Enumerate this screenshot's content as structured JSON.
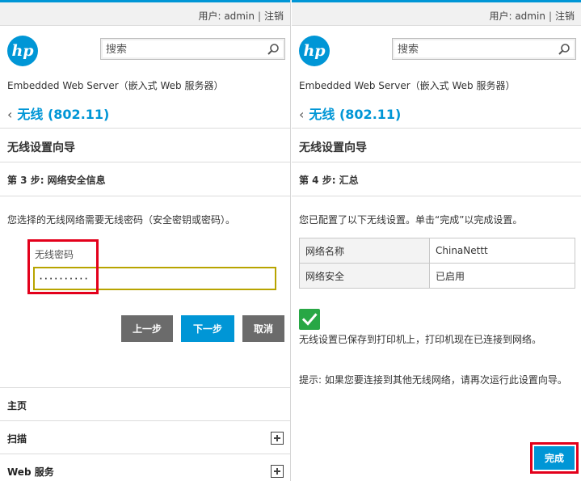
{
  "header": {
    "user_label": "用户: admin",
    "separator": "|",
    "logout_label": "注销"
  },
  "brand": {
    "logo": "hp-logo",
    "logo_text": "hp",
    "product_name": "Embedded Web Server（嵌入式 Web 服务器）",
    "accent_color": "#0096d6"
  },
  "search": {
    "placeholder": "搜索",
    "icon": "search-icon"
  },
  "breadcrumb": {
    "back_icon": "chevron-left-icon",
    "label": "无线 (802.11)"
  },
  "wizard": {
    "title": "无线设置向导"
  },
  "step3": {
    "title": "第 3 步: 网络安全信息",
    "description": "您选择的无线网络需要无线密码（安全密钥或密码）。",
    "password_label": "无线密码",
    "password_value": "··········",
    "buttons": {
      "back": "上一步",
      "next": "下一步",
      "cancel": "取消"
    }
  },
  "nav": {
    "items": [
      {
        "label": "主页",
        "expandable": false
      },
      {
        "label": "扫描",
        "expandable": true
      },
      {
        "label": "Web 服务",
        "expandable": true
      }
    ]
  },
  "step4": {
    "title": "第 4 步: 汇总",
    "description": "您已配置了以下无线设置。单击“完成”以完成设置。",
    "summary": [
      {
        "key": "网络名称",
        "value": "ChinaNettt"
      },
      {
        "key": "网络安全",
        "value": "已启用"
      }
    ],
    "success_icon": "checkmark-icon",
    "saved_message": "无线设置已保存到打印机上，打印机现在已连接到网络。",
    "hint": "提示: 如果您要连接到其他无线网络，请再次运行此设置向导。",
    "finish_button": "完成"
  },
  "colors": {
    "highlight": "#e3001b",
    "primary_button": "#0096d6",
    "secondary_button": "#6b6b6b",
    "success": "#28a745"
  }
}
